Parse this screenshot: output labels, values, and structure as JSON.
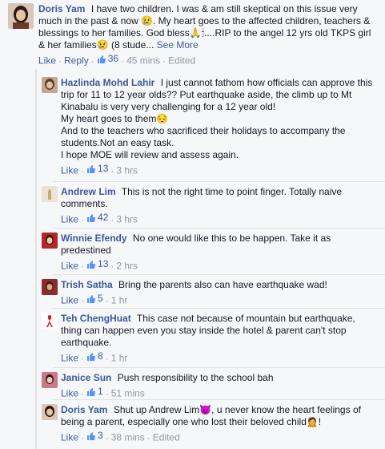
{
  "comments": [
    {
      "name": "Doris Yam",
      "text": "I have two children. I was & am still skeptical on this issue very much in the past & now 😢. My heart goes to the affected children, teachers & blessings to her families. God bless🙏🕯....RIP to the angel 12 yrs old TKPS girl & her families😢 (8 stude...",
      "see_more": "See More",
      "like": "Like",
      "reply": "Reply",
      "likes": "36",
      "time": "45 mins",
      "edited": "Edited"
    },
    {
      "name": "Hazlinda Mohd Lahir",
      "text": "I just cannot fathom how officials can approve this trip for 11 to 12 year olds?? Put earthquake aside, the climb up to Mt Kinabalu is very very challenging for a 12 year old!\nMy heart goes to them😔\nAnd to the teachers who sacrificed their holidays to accompany the students.Not an easy task.\nI hope MOE will review and assess again.",
      "like": "Like",
      "likes": "13",
      "time": "3 hrs"
    },
    {
      "name": "Andrew Lim",
      "text": "This is not the right time to point finger. Totally naive comments.",
      "like": "Like",
      "likes": "42",
      "time": "3 hrs"
    },
    {
      "name": "Winnie Efendy",
      "text": "No one would like this to be happen. Take it as predestined",
      "like": "Like",
      "likes": "13",
      "time": "2 hrs"
    },
    {
      "name": "Trish Satha",
      "text": "Bring the parents also can have earthquake wad!",
      "like": "Like",
      "likes": "5",
      "time": "1 hr"
    },
    {
      "name": "Teh ChengHuat",
      "text": "This case not because of mountain but earthquake, thing can happen even you stay inside the hotel & parent can't stop earthquake.",
      "like": "Like",
      "likes": "8",
      "time": "1 hr"
    },
    {
      "name": "Janice Sun",
      "text": "Push responsibility to the school bah",
      "like": "Like",
      "likes": "1",
      "time": "51 mins"
    },
    {
      "name": "Doris Yam",
      "text": "Shut up Andrew Lim😈, u never know the heart feelings of being a parent, especially one who lost their beloved child🙍!",
      "like": "Like",
      "likes": "3",
      "time": "38 mins",
      "edited": "Edited"
    }
  ],
  "colors": {
    "link": "#3b5998",
    "meta": "#9197a3",
    "text": "#141823",
    "background": "#f6f7f9"
  }
}
